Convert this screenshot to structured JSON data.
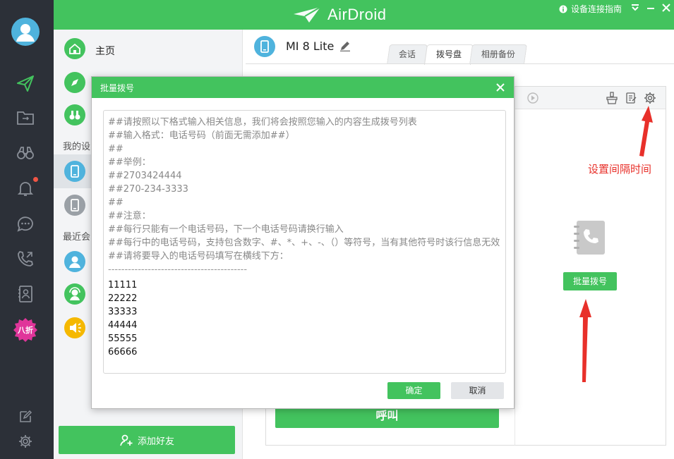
{
  "app": {
    "logo_text": "AirDroid"
  },
  "topbar": {
    "guide_label": "设备连接指南"
  },
  "sidebar": {
    "badge_label": "八折",
    "icons": [
      "send-icon",
      "folder-transfer-icon",
      "binoculars-icon",
      "bell-icon",
      "chat-icon",
      "phone-call-icon",
      "contacts-icon",
      "note-icon",
      "settings-icon"
    ]
  },
  "contacts": {
    "home_label": "主页",
    "my_devices_label": "我的设",
    "recent_label": "最近会",
    "add_friend_label": "添加好友"
  },
  "device": {
    "name": "MI 8 Lite"
  },
  "tabs": [
    {
      "label": "会话"
    },
    {
      "label": "拨号盘"
    },
    {
      "label": "相册备份"
    }
  ],
  "dialer": {
    "batch_dial_label": "批量拨号",
    "call_label": "呼叫"
  },
  "annotations": {
    "interval_note": "设置间隔时间"
  },
  "modal": {
    "title": "批量拨号",
    "instructions": [
      "##请按照以下格式输入相关信息，我们将会按照您输入的内容生成拨号列表",
      "##输入格式：电话号码（前面无需添加##）",
      "##",
      "##举例：",
      "##2703424444",
      "##270-234-3333",
      "##",
      "##注意：",
      "##每行只能有一个电话号码，下一个电话号码请换行输入",
      "##每行中的电话号码，支持包含数字、#、*、+、-、（）等符号，当有其他符号时该行信息无效",
      "##请将要导入的电话号码填写在横线下方："
    ],
    "separator": "------------------------------------------",
    "numbers": [
      "11111",
      "22222",
      "33333",
      "44444",
      "55555",
      "66666"
    ],
    "confirm_label": "确定",
    "cancel_label": "取消"
  },
  "colors": {
    "brand_green": "#43c35e",
    "rail_dark": "#2c3038",
    "annotation_red": "#e8302a"
  }
}
